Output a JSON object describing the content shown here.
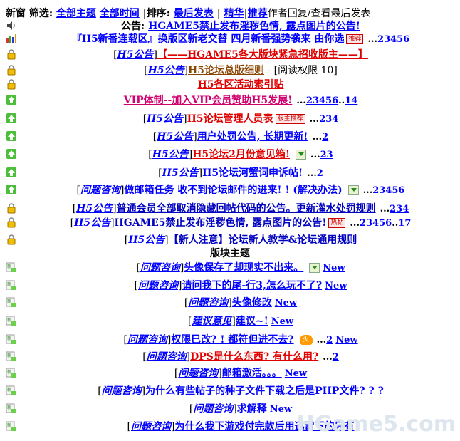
{
  "toolbar": {
    "label1": "新窗",
    "label2": "筛选:",
    "filter_all_topics": "全部主题",
    "filter_all_time": "全部时间",
    "sep_sort": "|排序:",
    "sort_last_post": "最后发表",
    "sep": "|",
    "filter_digest": "精华",
    "sep2": "|",
    "filter_recommend": "推荐",
    "legend_text": "作者回复/查看最后发表"
  },
  "announcement": {
    "label": "公告:",
    "text": "HGAME5禁止发布淫秽色情, 露点图片的公告!"
  },
  "sticky": [
    {
      "icon": "pie-chart-icon",
      "title": "『H5新番连载区』换版区新老交替 四月新番强势袭来 由你选",
      "tag": "推荐",
      "pages": [
        "23456"
      ],
      "last": "..."
    },
    {
      "icon": "lock-icon",
      "cat": "H5公告",
      "title": "【——HGAME5各大版块紧急招收版主——】"
    },
    {
      "icon": "lock-icon",
      "cat": "H5公告",
      "title": "H5论坛总版细则",
      "suffix": " - [阅读权限 10]"
    },
    {
      "icon": "lock-icon",
      "title": "H5各区活动索引贴"
    },
    {
      "icon": "up-arrow-icon",
      "title": "VIP体制--加入VIP会员赞助H5发展!",
      "pages": [
        "23456",
        "14"
      ]
    },
    {
      "icon": "up-arrow-icon",
      "cat": "H5公告",
      "title": "H5论坛管理人员表",
      "tag": "版主推荐",
      "pages": [
        "234"
      ]
    },
    {
      "icon": "up-arrow-icon",
      "cat": "H5公告",
      "title": "用户处罚公告, 长期更新!",
      "pages": [
        "2"
      ]
    },
    {
      "icon": "up-arrow-icon",
      "cat": "H5公告",
      "title": "H5论坛2月份意见箱!",
      "pages": [
        "23"
      ]
    },
    {
      "icon": "up-arrow-icon",
      "cat": "H5公告",
      "title": "H5论坛河蟹词申诉帖!",
      "pages": [
        "2"
      ]
    },
    {
      "icon": "up-arrow-icon",
      "cat": "问题咨询",
      "title": "做邮箱任务 收不到论坛邮件的进来! ! (解决办法)",
      "pages": [
        "23456"
      ]
    },
    {
      "icon": "lock-icon",
      "cat": "H5公告",
      "title": "普通会员全部取消隐藏回帖代码的公告。更新灌水处罚规则",
      "pages": [
        "234"
      ]
    },
    {
      "icon": "lock-icon",
      "cat": "H5公告",
      "title": "HGAME5禁止发布淫秽色情, 露点图片的公告!",
      "tag": "热帖",
      "pages": [
        "23456",
        "17"
      ]
    },
    {
      "icon": "lock-icon",
      "cat": "H5公告",
      "title": "【新人注意】论坛新人教学&论坛通用规则"
    }
  ],
  "section_title": "版块主题",
  "threads": [
    {
      "cat": "问题咨询",
      "title": "头像保存了却现实不出来。",
      "new": "New"
    },
    {
      "cat": "问题咨询",
      "title": "请问我下的尾-行3,怎么玩不了?",
      "new": "New"
    },
    {
      "cat": "问题咨询",
      "title": "头像修改",
      "new": "New"
    },
    {
      "cat": "建议意见",
      "title": "建议~!",
      "new": "New"
    },
    {
      "cat": "问题咨询",
      "title": "权限已改? ! 都符但进不去?",
      "pages": [
        "2"
      ],
      "new": "New"
    },
    {
      "cat": "问题咨询",
      "title": "DPS是什么东西? 有什么用?",
      "pages": [
        "2"
      ]
    },
    {
      "cat": "问题咨询",
      "title": "邮箱激活。。。",
      "new": "New"
    },
    {
      "cat": "问题咨询",
      "title": "为什么有些帖子的种子文件下载之后是PHP文件? ? ?"
    },
    {
      "cat": "问题咨询",
      "title": "求解释",
      "new": "New"
    },
    {
      "cat": "问题咨询",
      "title": "为什么我下游戏付完款后用迅雷下的只有"
    }
  ],
  "watermark": "HGame5.com",
  "colors": {
    "link": "#0000ff",
    "notice_red": "#e00000",
    "vip_pink": "#d0006f"
  }
}
